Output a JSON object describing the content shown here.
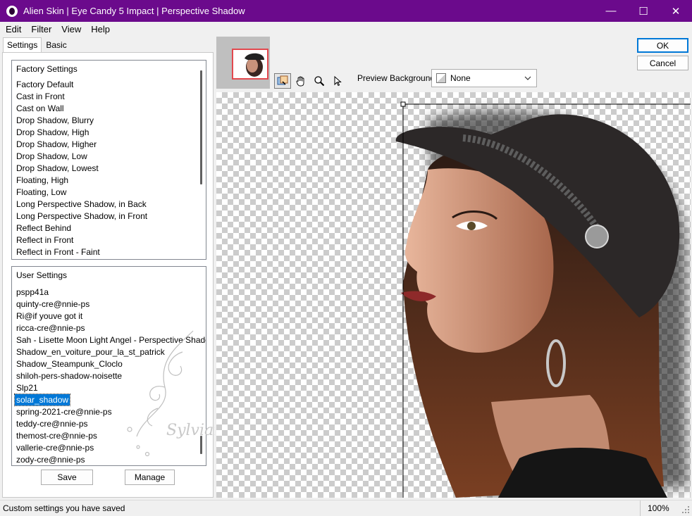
{
  "window": {
    "title": "Alien Skin | Eye Candy 5 Impact | Perspective Shadow",
    "minimize_glyph": "—",
    "maximize_glyph": "☐",
    "close_glyph": "✕",
    "accent_color": "#6b0a8c"
  },
  "menu": {
    "edit": "Edit",
    "filter": "Filter",
    "view": "View",
    "help": "Help"
  },
  "tabs": {
    "settings": "Settings",
    "basic": "Basic"
  },
  "factory": {
    "heading": "Factory Settings",
    "items": [
      "Factory Default",
      "Cast in Front",
      "Cast on Wall",
      "Drop Shadow, Blurry",
      "Drop Shadow, High",
      "Drop Shadow, Higher",
      "Drop Shadow, Low",
      "Drop Shadow, Lowest",
      "Floating, High",
      "Floating, Low",
      "Long Perspective Shadow, in Back",
      "Long Perspective Shadow, in Front",
      "Reflect Behind",
      "Reflect in Front",
      "Reflect in Front - Faint"
    ]
  },
  "user": {
    "heading": "User Settings",
    "items": [
      "pspp41a",
      "quinty-cre@nnie-ps",
      "Ri@if youve got it",
      "ricca-cre@nnie-ps",
      "Sah - Lisette Moon Light Angel - Perspective Shadow",
      "Shadow_en_voiture_pour_la_st_patrick",
      "Shadow_Steampunk_Cloclo",
      "shiloh-pers-shadow-noisette",
      "Slp21",
      "solar_shadow",
      "spring-2021-cre@nnie-ps",
      "teddy-cre@nnie-ps",
      "themost-cre@nnie-ps",
      "vallerie-cre@nnie-ps",
      "zody-cre@nnie-ps"
    ],
    "selected_index": 9
  },
  "buttons": {
    "save": "Save",
    "manage": "Manage",
    "ok": "OK",
    "cancel": "Cancel"
  },
  "preview_background": {
    "label": "Preview Background:",
    "value": "None"
  },
  "tools": [
    "navigator-tool",
    "hand-tool",
    "zoom-tool",
    "pointer-tool"
  ],
  "watermark_text": "Sylviane",
  "status": {
    "message": "Custom settings you have saved",
    "zoom": "100%"
  }
}
